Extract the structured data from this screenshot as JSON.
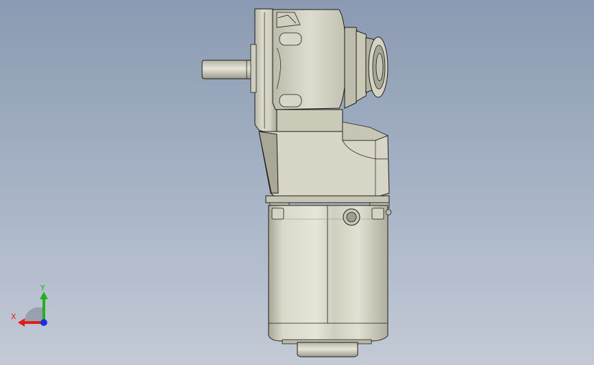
{
  "viewport": {
    "colors": {
      "bg_top": "#8b9ab2",
      "bg_bottom": "#c3cad6"
    },
    "model": {
      "shade_light": "#e4e4d9",
      "shade_mid": "#c9c8b8",
      "shade_dark": "#9e9d8d",
      "edge": "#1a1a1a"
    }
  },
  "triad": {
    "x_label": "X",
    "y_label": "Y",
    "colors": {
      "x": "#e41b17",
      "y": "#1fb01a",
      "z": "#1830e0"
    }
  }
}
